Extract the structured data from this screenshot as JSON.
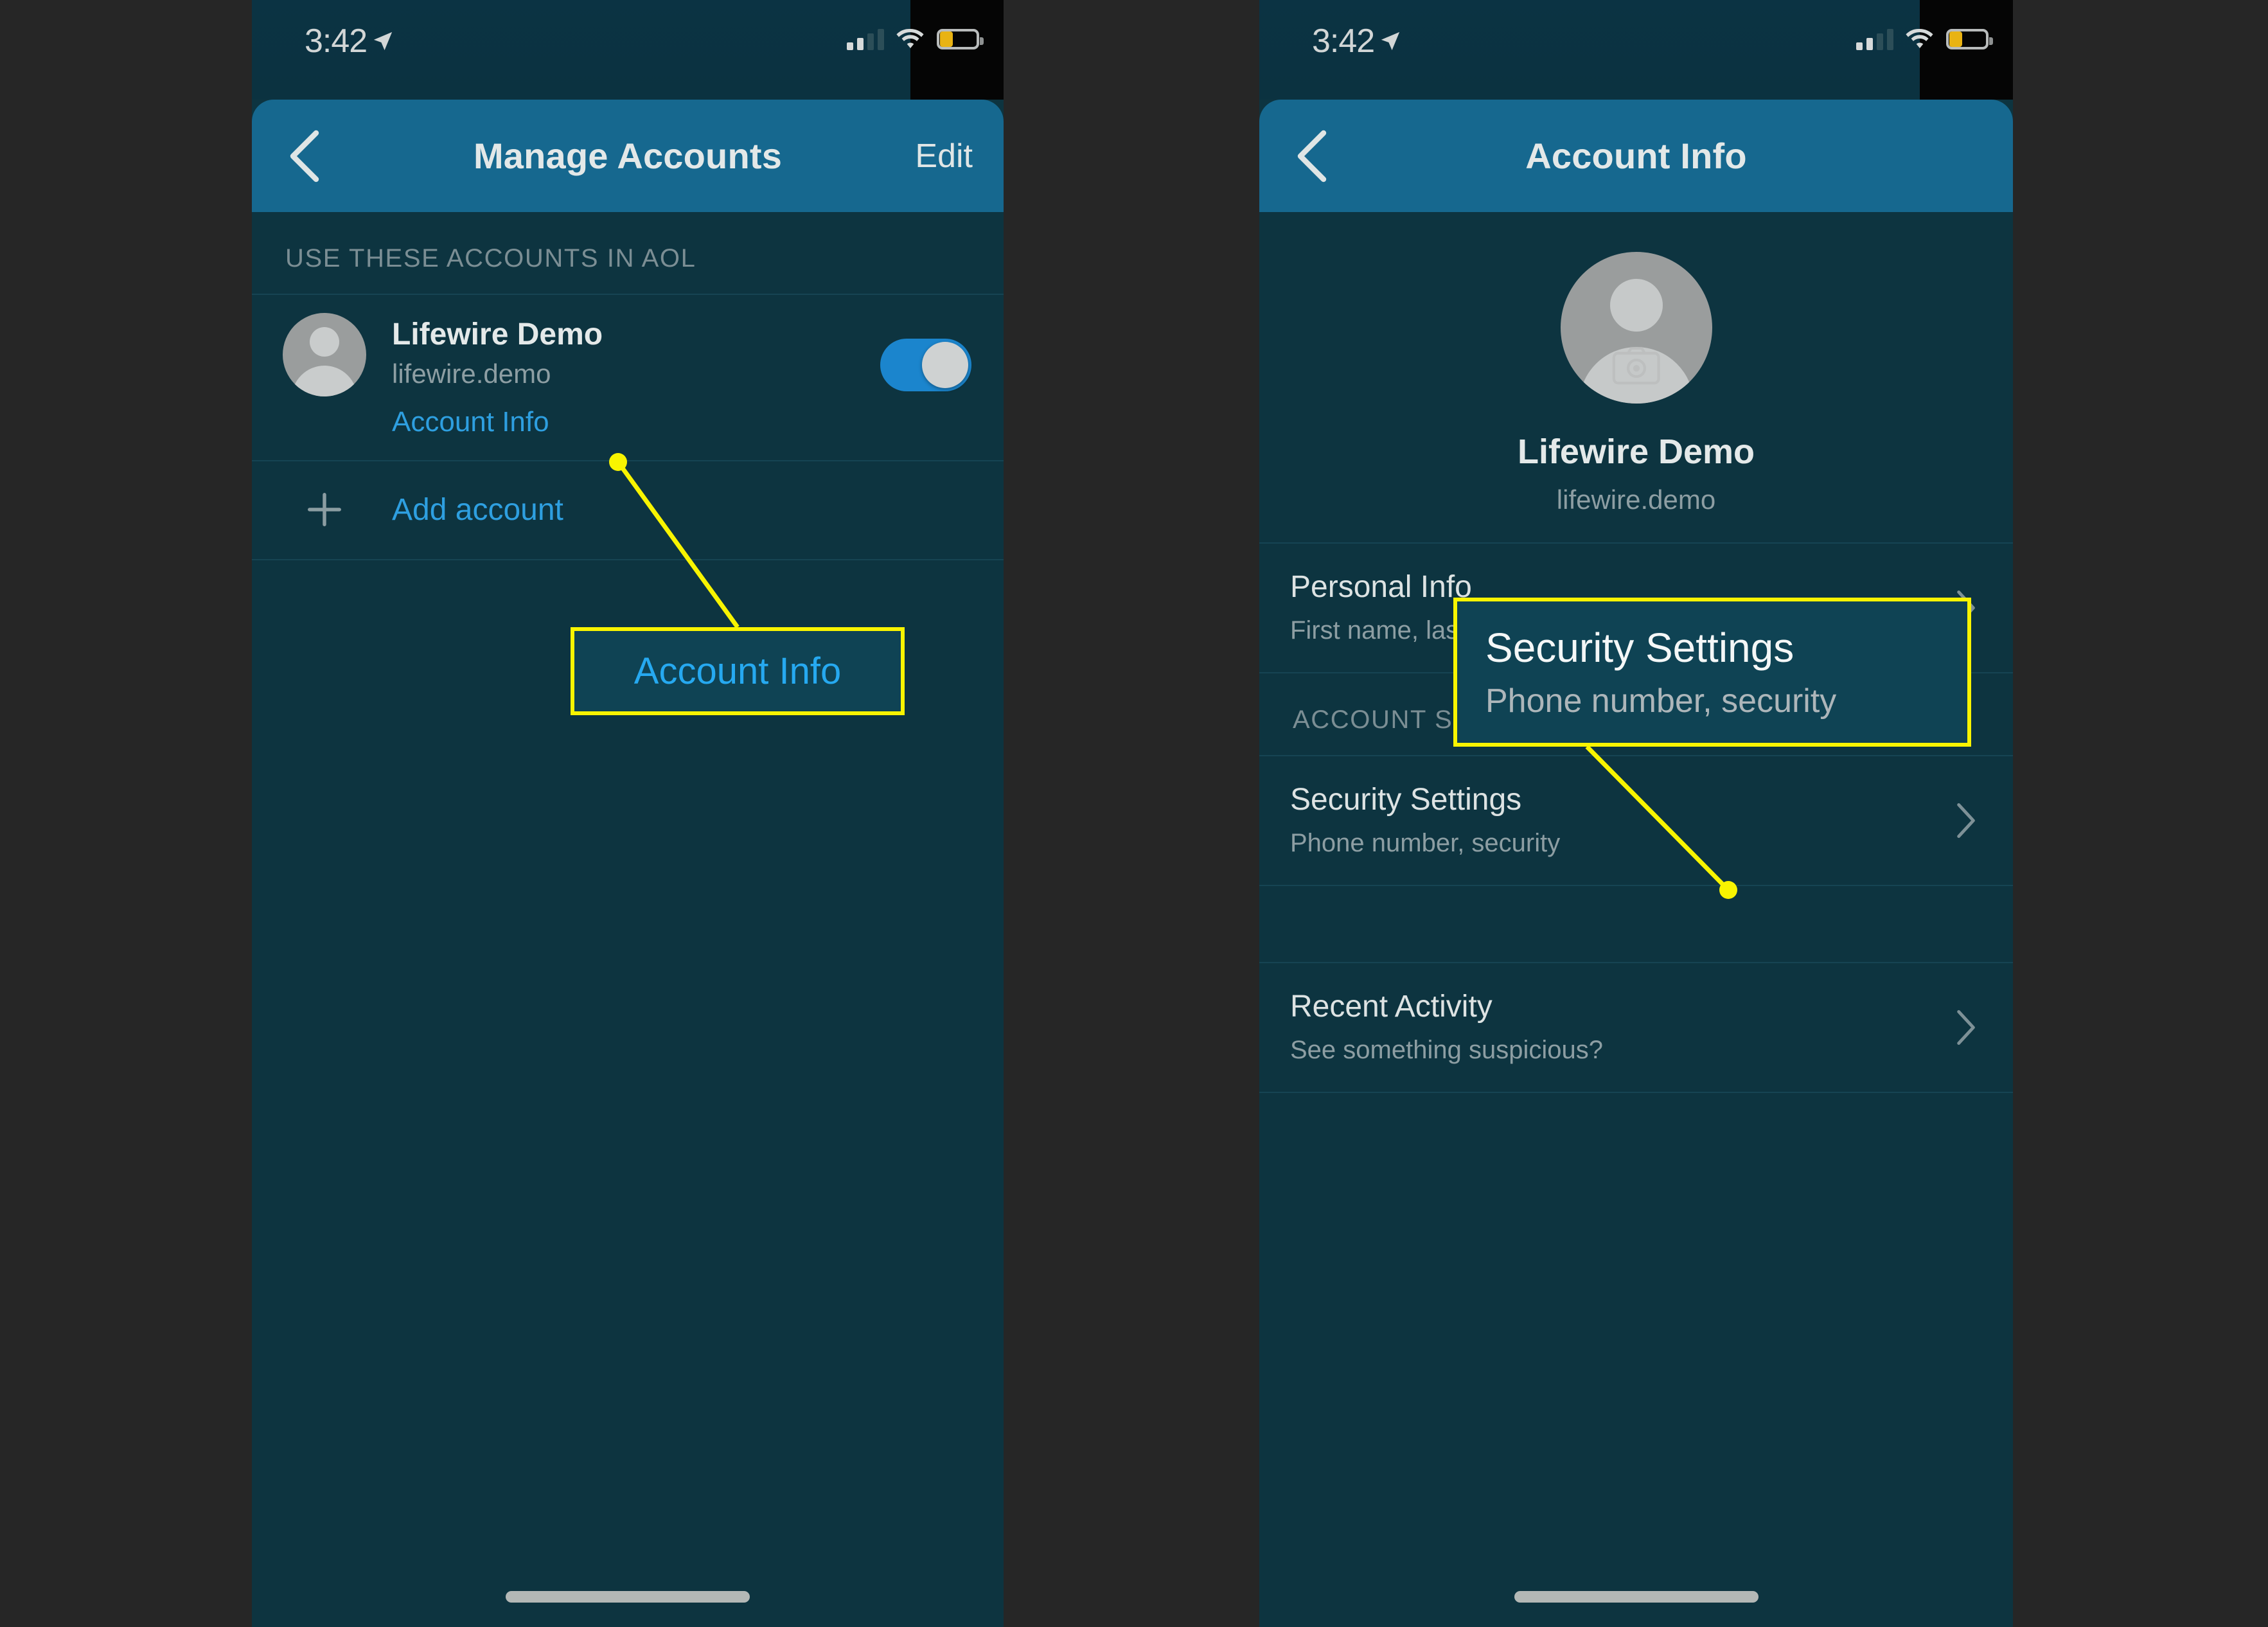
{
  "theme": {
    "page_bg": "#262626",
    "screen_bg": "#0d3440",
    "navbar_bg": "#16688f",
    "accent_link": "#2e9fe0",
    "callout_border": "#f8f400",
    "battery_color": "#e9b313",
    "toggle_on": "#1b85cd"
  },
  "left_phone": {
    "status": {
      "time": "3:42",
      "location_icon": "location-arrow-icon",
      "signal_icon": "cellular-signal-icon",
      "signal_bars_filled": 2,
      "signal_bars_total": 4,
      "wifi_icon": "wifi-icon",
      "battery_icon": "battery-low-icon",
      "battery_level": "34"
    },
    "navbar": {
      "back_icon": "chevron-left-icon",
      "title": "Manage Accounts",
      "edit_label": "Edit"
    },
    "section_header": "USE THESE ACCOUNTS IN AOL",
    "account": {
      "avatar_icon": "person-avatar-icon",
      "name": "Lifewire Demo",
      "username": "lifewire.demo",
      "link_label": "Account Info",
      "toggle_state": "on"
    },
    "add_account": {
      "icon": "plus-icon",
      "label": "Add account"
    },
    "callout": {
      "text": "Account Info"
    }
  },
  "right_phone": {
    "status": {
      "time": "3:42",
      "location_icon": "location-arrow-icon",
      "signal_icon": "cellular-signal-icon",
      "signal_bars_filled": 2,
      "signal_bars_total": 4,
      "wifi_icon": "wifi-icon",
      "battery_icon": "battery-low-icon",
      "battery_level": "34"
    },
    "navbar": {
      "back_icon": "chevron-left-icon",
      "title": "Account Info"
    },
    "profile": {
      "avatar_icon": "person-avatar-icon",
      "camera_icon": "camera-icon",
      "name": "Lifewire Demo",
      "username": "lifewire.demo"
    },
    "rows": [
      {
        "title": "Personal Info",
        "subtitle": "First name, last name, birthday",
        "chevron_icon": "chevron-right-icon"
      },
      {
        "title": "Security Settings",
        "subtitle": "Phone number, security",
        "chevron_icon": "chevron-right-icon"
      },
      {
        "title": "Recent Activity",
        "subtitle": "See something suspicious?",
        "chevron_icon": "chevron-right-icon"
      }
    ],
    "section_header": "ACCOUNT SECURITY",
    "callout": {
      "title": "Security Settings",
      "subtitle": "Phone number, security"
    }
  }
}
